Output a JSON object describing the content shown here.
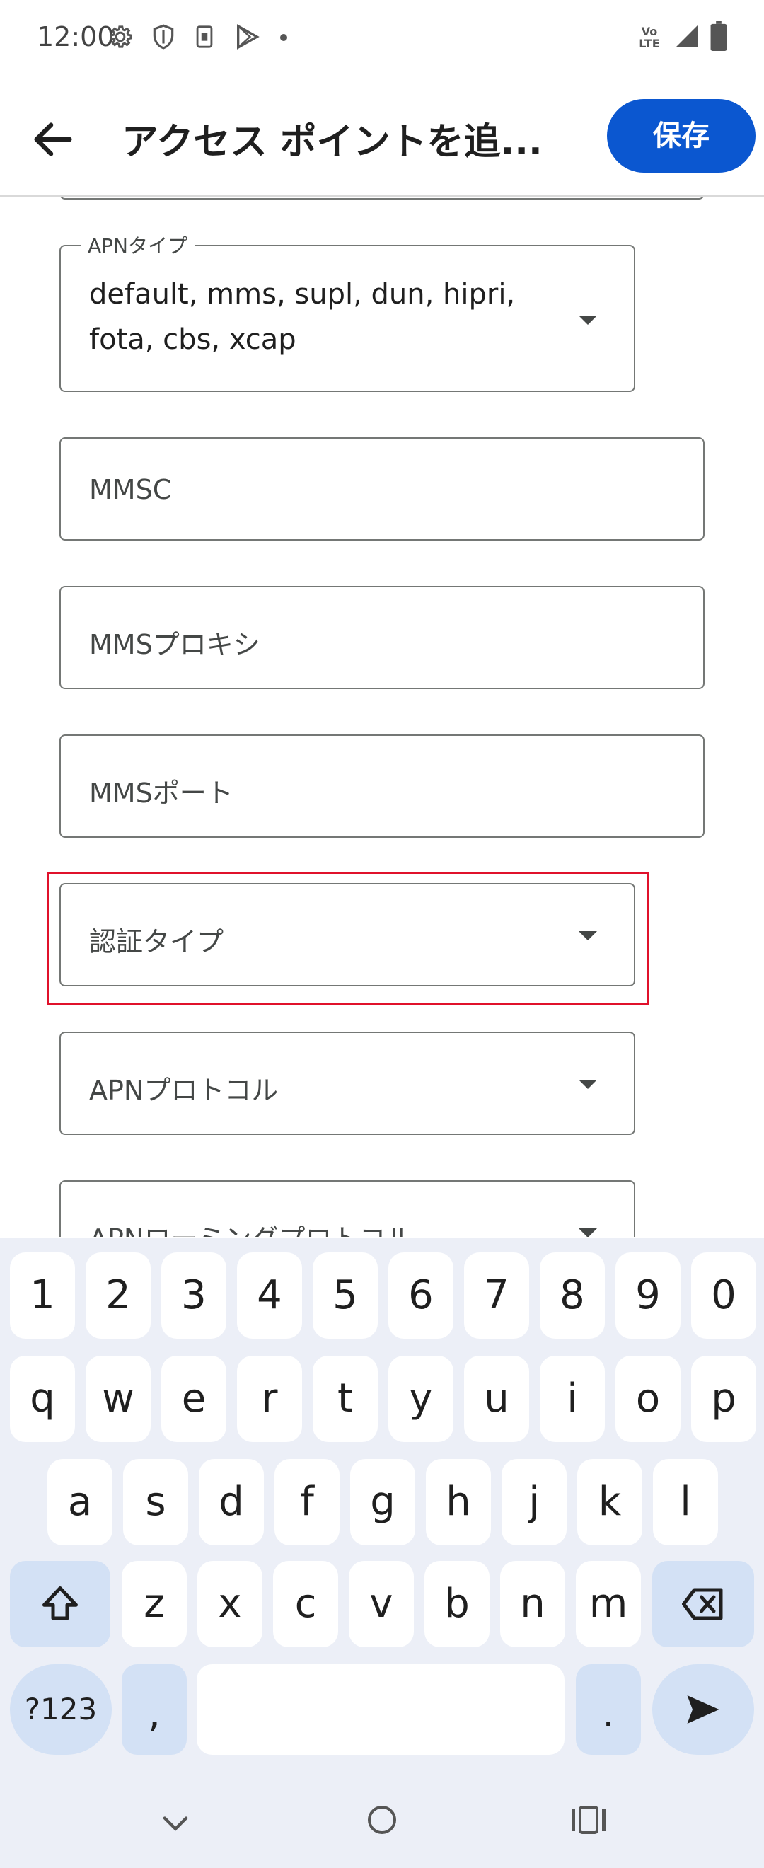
{
  "status_bar": {
    "time": "12:00",
    "left_icons": [
      "gear-icon",
      "shield-icon",
      "sim-icon",
      "play-store-icon",
      "dot-icon"
    ],
    "right_icons": [
      "volte-icon",
      "signal-icon",
      "battery-icon"
    ],
    "volte_text": "Vo LTE"
  },
  "app_bar": {
    "title": "アクセス ポイントを追...",
    "save_label": "保存"
  },
  "form": {
    "apn_type_label": "APNタイプ",
    "apn_type_value_line1": "default, mms, supl, dun, hipri,",
    "apn_type_value_line2": "fota, cbs, xcap",
    "mmsc": "MMSC",
    "mms_proxy": "MMSプロキシ",
    "mms_port": "MMSポート",
    "auth_type": "認証タイプ",
    "apn_protocol": "APNプロトコル",
    "apn_roaming_protocol": "APNローミングプロトコル"
  },
  "keyboard": {
    "row_numbers": [
      "1",
      "2",
      "3",
      "4",
      "5",
      "6",
      "7",
      "8",
      "9",
      "0"
    ],
    "row1": [
      "q",
      "w",
      "e",
      "r",
      "t",
      "y",
      "u",
      "i",
      "o",
      "p"
    ],
    "row2": [
      "a",
      "s",
      "d",
      "f",
      "g",
      "h",
      "j",
      "k",
      "l"
    ],
    "row3": [
      "z",
      "x",
      "c",
      "v",
      "b",
      "n",
      "m"
    ],
    "symbols_label": "?123",
    "comma": ",",
    "period": "."
  },
  "nav_bar": {
    "icons": [
      "back-chevron-icon",
      "home-icon",
      "recents-icon"
    ]
  },
  "colors": {
    "accent": "#0b57d0",
    "highlight": "#e0112b",
    "keyboard_bg": "#eceff7",
    "special_key": "#d3e1f5"
  }
}
